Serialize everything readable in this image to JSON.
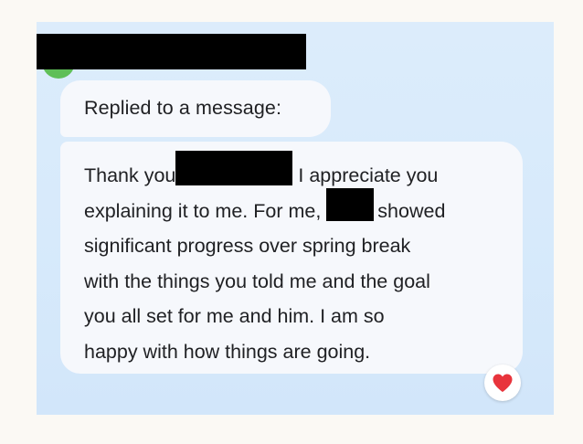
{
  "conversation": {
    "reply_label": "Replied to a message:",
    "message_lines": [
      {
        "before": "Thank you",
        "after": "I appreciate you"
      },
      {
        "before": "explaining it to me. For me,",
        "after": "showed"
      },
      {
        "text": "significant progress over spring break"
      },
      {
        "text": "with the things you told me and the goal"
      },
      {
        "text": "you all set for me and him. I am so"
      },
      {
        "text": "happy with how things are going."
      }
    ],
    "reaction": {
      "icon": "heart-icon",
      "color": "#e8343c"
    }
  },
  "colors": {
    "page_background": "#fbf9f4",
    "chat_background": "#d8ebfb",
    "bubble_background": "#f6f8fc",
    "text": "#202124",
    "avatar": "#5fbf57"
  }
}
